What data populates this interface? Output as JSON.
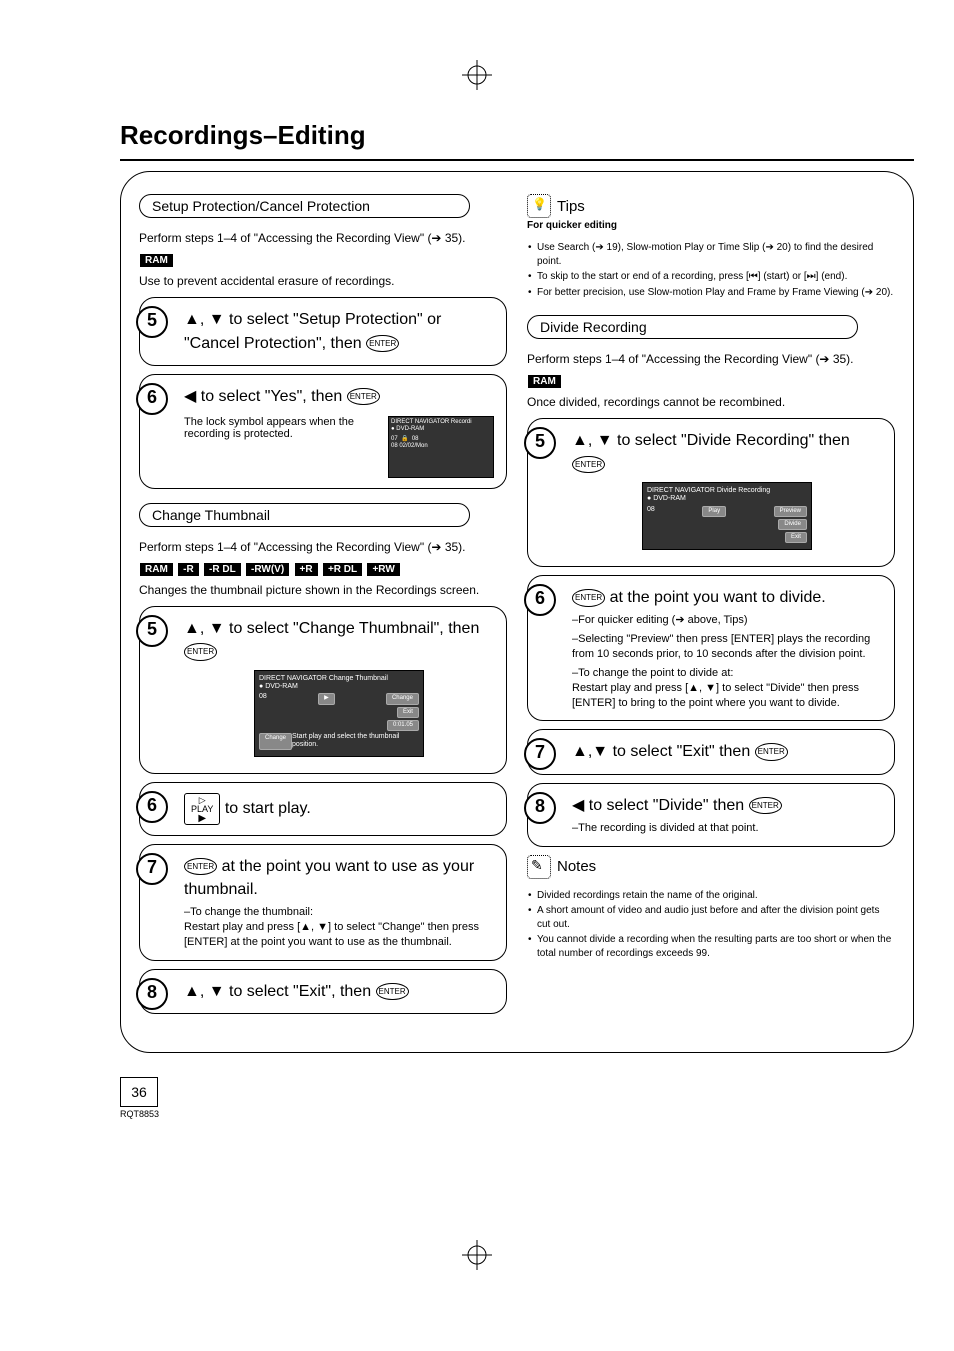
{
  "page": {
    "title": "Recordings–Editing",
    "number": "36",
    "model": "RQT8853"
  },
  "left": {
    "section1": {
      "header": "Setup Protection/Cancel Protection",
      "intro": "Perform steps 1–4 of \"Accessing the Recording View\" (➔ 35).",
      "ram": "RAM",
      "note": "Use to prevent accidental erasure of recordings.",
      "step5": "▲, ▼ to select \"Setup Protection\" or \"Cancel Protection\", then ",
      "step6": "◀ to select \"Yes\", then ",
      "lock_note": "The lock symbol appears when the recording is protected.",
      "mini_title": "DIRECT NAVIGATOR   Recordi",
      "mini_sub": "DVD-RAM",
      "mini_date": "08 02/02/Mon"
    },
    "section2": {
      "header": "Change Thumbnail",
      "intro": "Perform steps 1–4 of \"Accessing the Recording View\" (➔ 35).",
      "badges": [
        "RAM",
        "-R",
        "-R DL",
        "-RW(V)",
        "+R",
        "+R DL",
        "+RW"
      ],
      "note": "Changes the thumbnail picture shown in the Recordings screen.",
      "step5": "▲, ▼ to select \"Change Thumbnail\", then ",
      "sb_title": "DIRECT NAVIGATOR   Change Thumbnail",
      "sb_sub": "DVD-RAM",
      "sb_change": "Change",
      "sb_exit": "Exit",
      "sb_time": "0:01.05",
      "sb_help": "Start play and select the thumbnail position.",
      "step6": " to start play.",
      "step6_play_top": "▷",
      "step6_play_bot": "PLAY",
      "step7_main": " at the point you want to use as your thumbnail.",
      "step7_sub": "–To change the thumbnail:\n Restart play and press [▲, ▼] to select \"Change\" then press [ENTER] at the point you want to use as the thumbnail.",
      "step8": "▲, ▼ to select \"Exit\", then "
    }
  },
  "right": {
    "tips": {
      "title": "Tips",
      "sub": "For quicker editing",
      "items": [
        "Use Search (➔ 19), Slow-motion Play or Time Slip (➔ 20) to find the desired point.",
        "To skip to the start or end of a recording, press [⏮] (start) or [⏭] (end).",
        "For better precision, use Slow-motion Play and Frame by Frame Viewing (➔ 20)."
      ]
    },
    "section": {
      "header": "Divide Recording",
      "intro": "Perform steps 1–4 of \"Accessing the Recording View\" (➔ 35).",
      "ram": "RAM",
      "note": "Once divided, recordings cannot be recombined.",
      "step5": "▲, ▼ to select \"Divide Recording\" then ",
      "sb_title": "DIRECT NAVIGATOR   Divide Recording",
      "sb_sub": "DVD-RAM",
      "sb_play": "Play",
      "sb_preview": "Preview",
      "sb_divide": "Divide",
      "sb_exit": "Exit",
      "step6_main": " at the point you want to divide.",
      "step6_sub1": "–For quicker editing (➔ above, Tips)",
      "step6_sub2": "–Selecting \"Preview\" then press [ENTER] plays the recording from 10 seconds prior, to 10 seconds after the division point.",
      "step6_sub3": "–To change the point to divide at:\n Restart play and press [▲, ▼] to select \"Divide\" then press [ENTER] to bring to the point where you want to divide.",
      "step7": "▲,▼ to select \"Exit\" then ",
      "step8": "◀ to select \"Divide\" then ",
      "step8_sub": "–The recording is divided at that point."
    },
    "notes": {
      "title": "Notes",
      "items": [
        "Divided recordings retain the name of the original.",
        "A short amount of video and audio just before and after the division point gets cut out.",
        "You cannot divide a recording when the resulting parts are too short or when the total number of recordings exceeds 99."
      ]
    }
  },
  "enter_label": "ENTER"
}
